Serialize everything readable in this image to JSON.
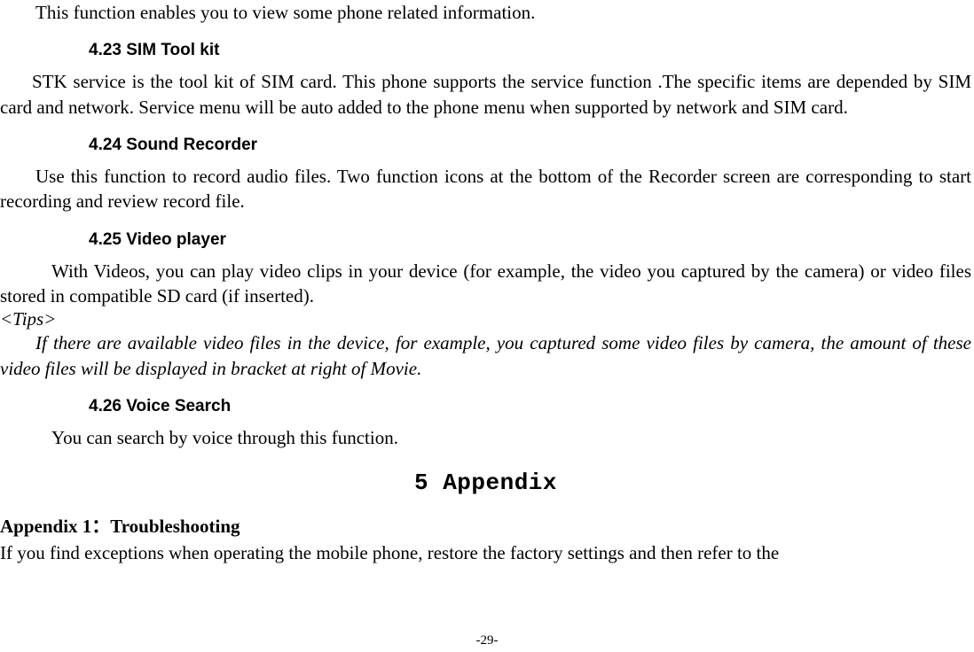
{
  "intro_line": "This function enables you to view some phone related information.",
  "s423": {
    "heading": "4.23  SIM Tool kit",
    "body": "STK service is the tool kit of SIM card. This phone supports the service function .The specific items are depended by SIM card and network. Service menu will be auto added to the phone menu when supported by network and SIM card."
  },
  "s424": {
    "heading": "4.24  Sound Recorder",
    "body": "Use this function to record audio files. Two function icons at the bottom of the Recorder screen are corresponding to start recording and review record file."
  },
  "s425": {
    "heading": "4.25  Video player",
    "body": "With Videos, you can play video clips in your device (for example, the video you captured by the camera) or video files stored in compatible SD card (if inserted).",
    "tips_label": "<Tips>",
    "tips_body": "If there are available video files in the device, for example, you captured some video files by camera, the amount of these video files will be displayed in bracket at right of Movie."
  },
  "s426": {
    "heading": "4.26  Voice Search",
    "body": "You can search by voice through this function."
  },
  "chapter": "5 Appendix",
  "appendix1": {
    "heading": "Appendix 1：Troubleshooting",
    "body": "If you find exceptions when operating the mobile phone, restore the factory settings and then refer to the"
  },
  "page_number": "-29-"
}
